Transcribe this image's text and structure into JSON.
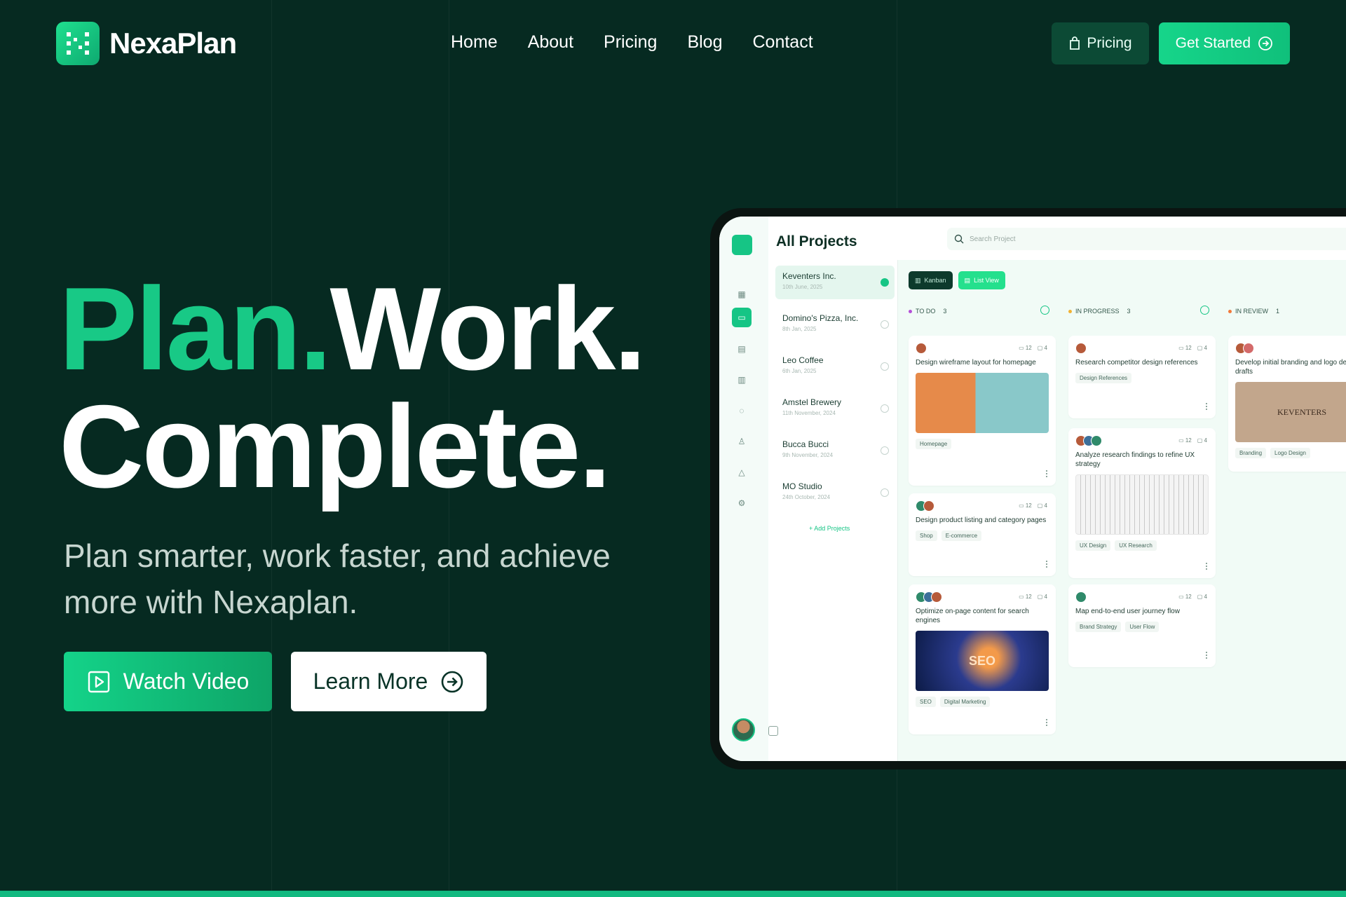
{
  "brand": {
    "name": "NexaPlan"
  },
  "nav": {
    "links": [
      "Home",
      "About",
      "Pricing",
      "Blog",
      "Contact"
    ],
    "pricing_button": "Pricing",
    "cta_button": "Get Started"
  },
  "hero": {
    "title_accent": "Plan.",
    "title_rest": "Work.",
    "title_line2": "Complete.",
    "subtitle": "Plan smarter, work faster, and achieve more with Nexaplan.",
    "watch_button": "Watch Video",
    "learn_button": "Learn More"
  },
  "app": {
    "title": "All Projects",
    "search_placeholder": "Search Project",
    "projects": [
      {
        "name": "Keventers Inc.",
        "date": "10th June, 2025",
        "active": true
      },
      {
        "name": "Domino's Pizza, Inc.",
        "date": "8th Jan, 2025",
        "active": false
      },
      {
        "name": "Leo Coffee",
        "date": "6th Jan, 2025",
        "active": false
      },
      {
        "name": "Amstel Brewery",
        "date": "11th November, 2024",
        "active": false
      },
      {
        "name": "Bucca Bucci",
        "date": "9th November, 2024",
        "active": false
      },
      {
        "name": "MO Studio",
        "date": "24th October, 2024",
        "active": false
      }
    ],
    "add_projects": "Add Projects",
    "views": {
      "kanban": "Kanban",
      "list": "List View"
    },
    "columns": [
      {
        "name": "TO DO",
        "count": "3",
        "color": "#b44fd8"
      },
      {
        "name": "IN PROGRESS",
        "count": "3",
        "color": "#f2b233"
      },
      {
        "name": "IN REVIEW",
        "count": "1",
        "color": "#f2793a"
      }
    ],
    "cards": {
      "todo1": {
        "title": "Design wireframe layout for homepage",
        "comments": "12",
        "files": "4",
        "tags": [
          "Homepage"
        ]
      },
      "todo2": {
        "title": "Design product listing and category pages",
        "comments": "12",
        "files": "4",
        "tags": [
          "Shop",
          "E-commerce"
        ]
      },
      "todo3": {
        "title": "Optimize on-page content for search engines",
        "comments": "12",
        "files": "4",
        "tags": [
          "SEO",
          "Digital Marketing"
        ],
        "image_text": "SEO"
      },
      "prog1": {
        "title": "Research competitor design references",
        "comments": "12",
        "files": "4",
        "tags": [
          "Design References"
        ]
      },
      "prog2": {
        "title": "Analyze research findings to refine UX strategy",
        "comments": "12",
        "files": "4",
        "tags": [
          "UX Design",
          "UX Research"
        ]
      },
      "prog3": {
        "title": "Map end-to-end user journey flow",
        "comments": "12",
        "files": "4",
        "tags": [
          "Brand Strategy",
          "User Flow"
        ]
      },
      "rev1": {
        "title": "Develop initial branding and logo design drafts",
        "tags": [
          "Branding",
          "Logo Design"
        ],
        "image_text": "KEVENTERS"
      }
    }
  },
  "colors": {
    "background": "#062a21",
    "accent": "#18c986",
    "strip": "#11b980"
  }
}
